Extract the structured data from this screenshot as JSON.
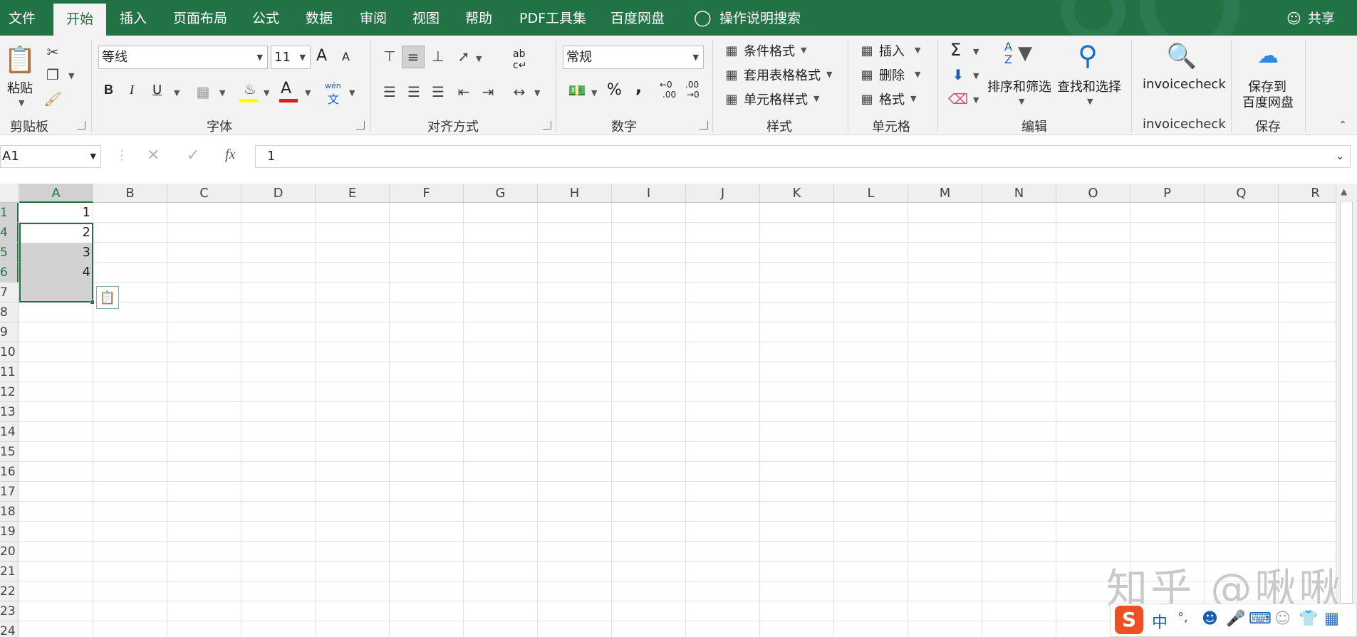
{
  "tabs": [
    "文件",
    "开始",
    "插入",
    "页面布局",
    "公式",
    "数据",
    "审阅",
    "视图",
    "帮助",
    "PDF工具集",
    "百度网盘"
  ],
  "tell_me": "操作说明搜索",
  "share": "共享",
  "ribbon": {
    "clipboard": {
      "paste": "粘贴",
      "group": "剪贴板"
    },
    "font": {
      "name": "等线",
      "size": "11",
      "bold": "B",
      "italic": "I",
      "underline": "U",
      "group": "字体",
      "grow": "A",
      "shrink": "A",
      "color_a": "A",
      "phonetic_top": "wén",
      "phonetic_bottom": "文"
    },
    "alignment": {
      "group": "对齐方式",
      "wrap_top": "ab",
      "wrap_bottom": "c↵"
    },
    "number": {
      "format": "常规",
      "group": "数字",
      "percent": "%",
      "comma": ",",
      "inc_top": "←0",
      "inc_bottom": ".00",
      "dec_top": ".00",
      "dec_bottom": "→0"
    },
    "styles": {
      "conditional": "条件格式",
      "table": "套用表格格式",
      "cell": "单元格样式",
      "group": "样式"
    },
    "cells": {
      "insert": "插入",
      "delete": "删除",
      "format": "格式",
      "group": "单元格"
    },
    "editing": {
      "sum": "Σ",
      "sort_filter": "排序和筛选",
      "find_select": "查找和选择",
      "group": "编辑",
      "sort_a": "A",
      "sort_z": "Z"
    },
    "invoice": {
      "label": "invoicecheck",
      "group": "invoicecheck"
    },
    "save": {
      "label1": "保存到",
      "label2": "百度网盘",
      "group": "保存"
    }
  },
  "formula_bar": {
    "name_box": "A1",
    "fx": "fx",
    "value": "1",
    "cancel": "✕",
    "enter": "✓"
  },
  "columns": [
    "A",
    "B",
    "C",
    "D",
    "E",
    "F",
    "G",
    "H",
    "I",
    "J",
    "K",
    "L",
    "M",
    "N",
    "O",
    "P",
    "Q",
    "R"
  ],
  "rows": [
    "1",
    "4",
    "5",
    "6",
    "7",
    "8",
    "9",
    "10",
    "11",
    "12",
    "13",
    "14",
    "15",
    "16",
    "17",
    "18",
    "19",
    "20",
    "21",
    "22",
    "23",
    "24"
  ],
  "cells": [
    {
      "row": "1",
      "col": "A",
      "value": "1"
    },
    {
      "row": "4",
      "col": "A",
      "value": "2"
    },
    {
      "row": "5",
      "col": "A",
      "value": "3"
    },
    {
      "row": "6",
      "col": "A",
      "value": "4"
    }
  ],
  "watermark": "知乎 @啾啾",
  "ime": {
    "logo": "S",
    "mode": "中",
    "punct": "°,"
  },
  "colors": {
    "excel_green": "#217346",
    "selection_fill": "#d2d2d2"
  }
}
